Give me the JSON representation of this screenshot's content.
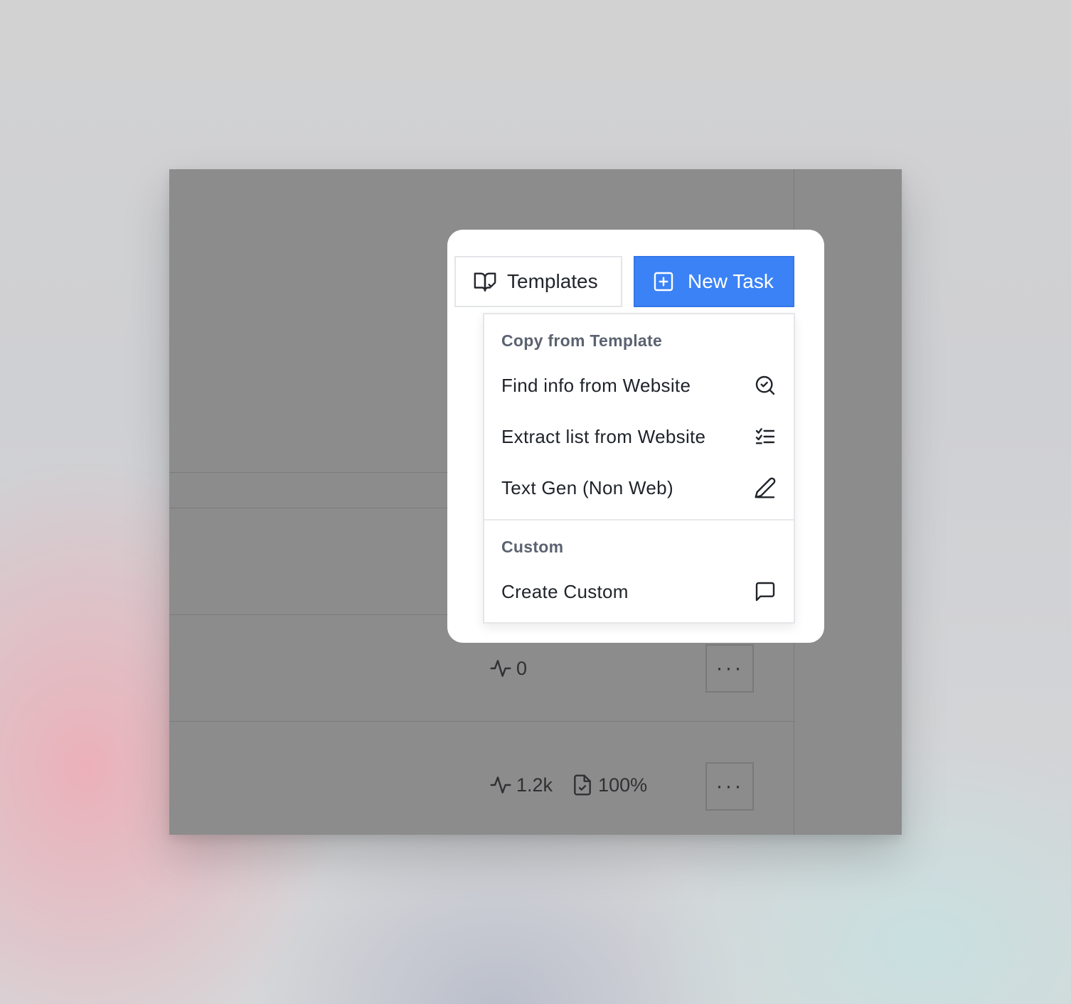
{
  "toolbar": {
    "templates_label": "Templates",
    "new_task_label": "New Task"
  },
  "dropdown": {
    "section_template": "Copy from Template",
    "items_template": [
      {
        "label": "Find info from Website",
        "icon": "search-check-icon"
      },
      {
        "label": "Extract list from Website",
        "icon": "checklist-icon"
      },
      {
        "label": "Text Gen (Non Web)",
        "icon": "pencil-icon"
      }
    ],
    "section_custom": "Custom",
    "items_custom": [
      {
        "label": "Create Custom",
        "icon": "message-square-icon"
      }
    ]
  },
  "rows": [
    {
      "activity": "0",
      "more": "···"
    },
    {
      "activity": "1.2k",
      "completion": "100%",
      "more": "···"
    }
  ],
  "colors": {
    "accent": "#3b82f6",
    "overlay": "#8c8c8c"
  }
}
